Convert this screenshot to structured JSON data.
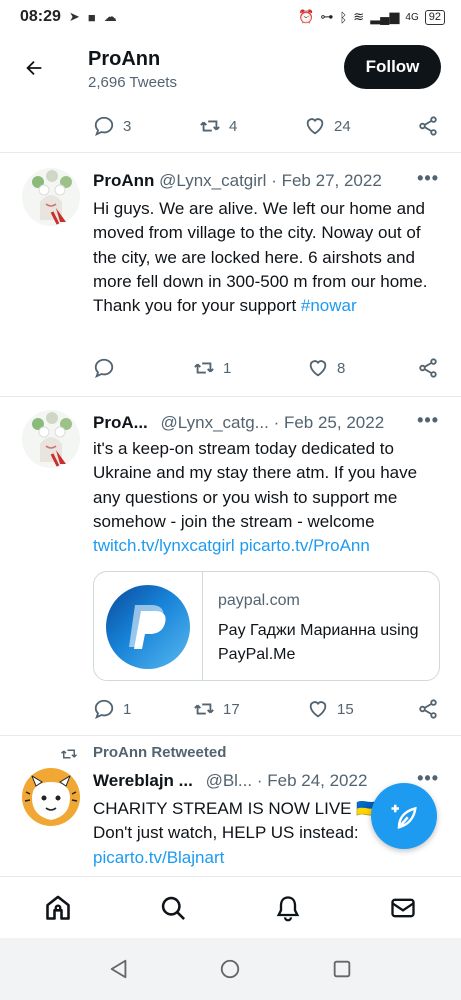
{
  "status_bar": {
    "time": "08:29",
    "network": "4G",
    "battery": "92"
  },
  "header": {
    "profile_name": "ProAnn",
    "tweet_count": "2,696 Tweets",
    "follow_label": "Follow"
  },
  "tweet0": {
    "replies": "3",
    "retweets": "4",
    "likes": "24"
  },
  "tweet1": {
    "name": "ProAnn",
    "handle": "@Lynx_catgirl",
    "date": "Feb 27, 2022",
    "text_before": "Hi guys. We are alive. We left our home and moved from village to the city. Noway out of the city, we are locked here. 6 airshots and more fell down in 300-500 m from our home. Thank you for your support ",
    "hashtag": "#nowar",
    "replies": "",
    "retweets": "1",
    "likes": "8"
  },
  "tweet2": {
    "name": "ProA...",
    "handle": "@Lynx_catg...",
    "date": "Feb 25, 2022",
    "text": "it's a keep-on stream today dedicated to Ukraine and my stay there atm. If you have any questions or you wish to support me somehow - join the stream - welcome",
    "link1": "twitch.tv/lynxcatgirl",
    "link2": "picarto.tv/ProAnn",
    "card": {
      "domain": "paypal.com",
      "title": "Pay Гаджи Марианна using PayPal.Me"
    },
    "replies": "1",
    "retweets": "17",
    "likes": "15"
  },
  "tweet3": {
    "retweeted_by": "ProAnn Retweeted",
    "name": "Wereblajn ...",
    "handle": "@Bl...",
    "date": "Feb 24, 2022",
    "line1": "CHARITY STREAM IS NOW LIVE 🇺🇦",
    "line2": "Don't just watch, HELP US instead:",
    "link": "picarto.tv/Blajnart"
  },
  "colors": {
    "accent": "#1d9bf0",
    "text": "#0f1419",
    "secondary": "#536471"
  },
  "icons": [
    "back-arrow-icon",
    "reply-icon",
    "retweet-icon",
    "like-icon",
    "share-icon",
    "more-icon",
    "compose-icon",
    "home-icon",
    "search-icon",
    "notifications-icon",
    "messages-icon"
  ]
}
